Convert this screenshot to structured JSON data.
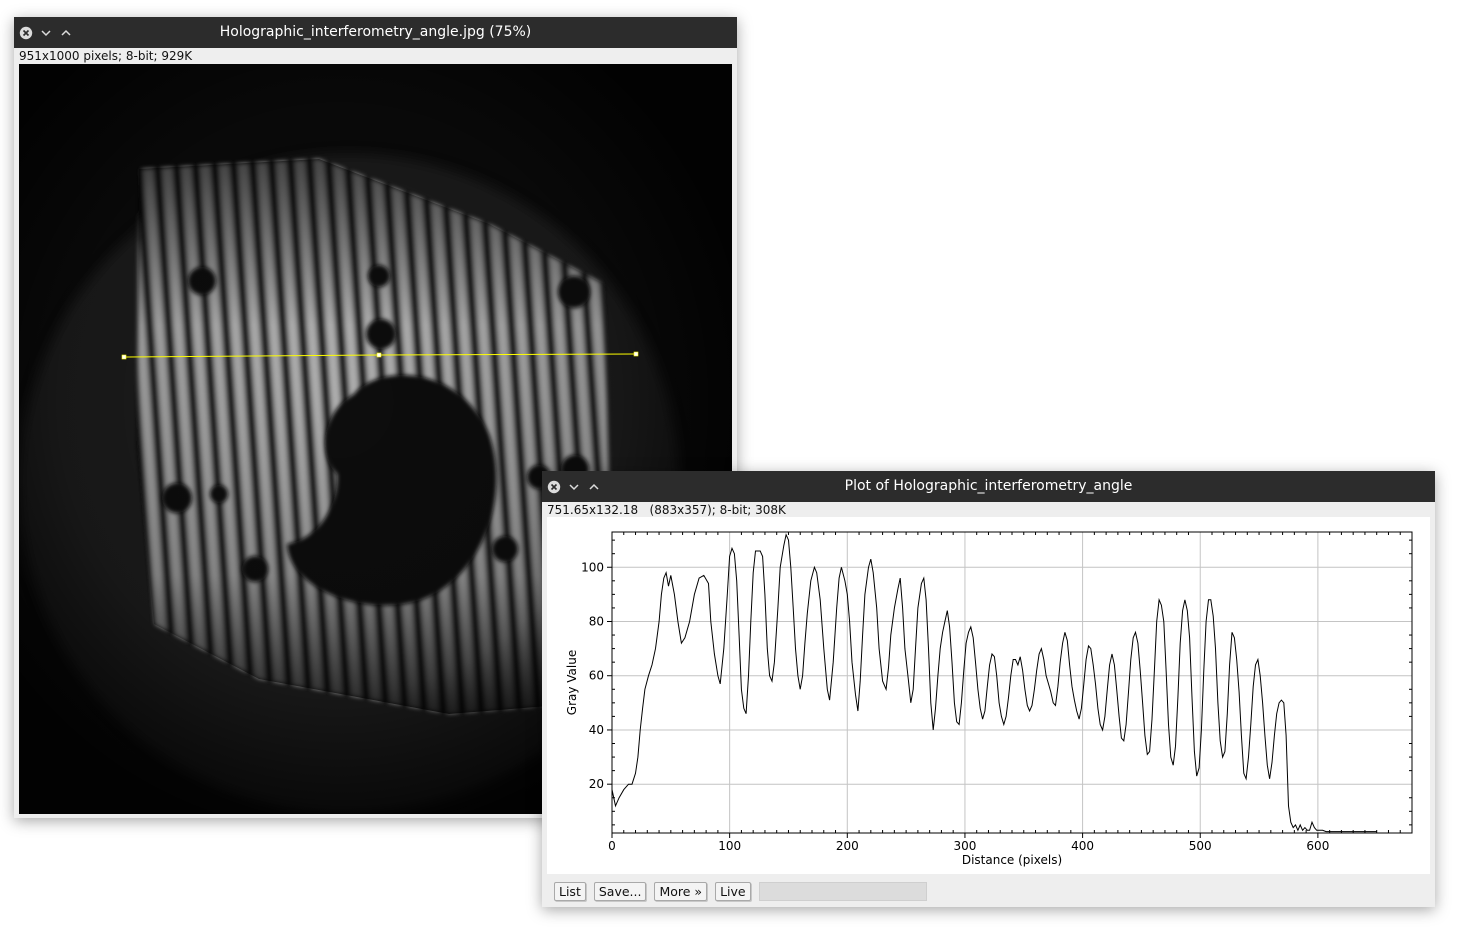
{
  "image_window": {
    "title": "Holographic_interferometry_angle.jpg (75%)",
    "info": "951x1000 pixels; 8-bit; 929K"
  },
  "plot_window": {
    "title": "Plot of Holographic_interferometry_angle",
    "info": "751.65x132.18   (883x357); 8-bit; 308K",
    "buttons": {
      "list": "List",
      "save": "Save...",
      "more": "More »",
      "live": "Live"
    }
  },
  "colors": {
    "titlebar": "#2c2c2c",
    "selection_line": "#ffff00",
    "plot_line": "#000000",
    "grid": "#bfbfbf"
  },
  "chart_data": {
    "type": "line",
    "xlabel": "Distance (pixels)",
    "ylabel": "Gray Value",
    "xlim": [
      0,
      680
    ],
    "ylim": [
      2,
      113
    ],
    "xticks": [
      0,
      100,
      200,
      300,
      400,
      500,
      600
    ],
    "yticks": [
      20,
      40,
      60,
      80,
      100
    ],
    "grid": true,
    "series": [
      {
        "points": [
          [
            0,
            18
          ],
          [
            3,
            12
          ],
          [
            6,
            15
          ],
          [
            10,
            18
          ],
          [
            14,
            20
          ],
          [
            17,
            20
          ],
          [
            20,
            24
          ],
          [
            22,
            30
          ],
          [
            24,
            40
          ],
          [
            26,
            48
          ],
          [
            28,
            55
          ],
          [
            31,
            60
          ],
          [
            34,
            64
          ],
          [
            37,
            70
          ],
          [
            40,
            80
          ],
          [
            42,
            90
          ],
          [
            44,
            96
          ],
          [
            46,
            98
          ],
          [
            48,
            93
          ],
          [
            50,
            97
          ],
          [
            53,
            90
          ],
          [
            56,
            80
          ],
          [
            59,
            72
          ],
          [
            62,
            74
          ],
          [
            66,
            80
          ],
          [
            70,
            90
          ],
          [
            74,
            96
          ],
          [
            78,
            97
          ],
          [
            82,
            94
          ],
          [
            84,
            80
          ],
          [
            87,
            68
          ],
          [
            90,
            60
          ],
          [
            92,
            57
          ],
          [
            95,
            70
          ],
          [
            98,
            90
          ],
          [
            100,
            104
          ],
          [
            102,
            107
          ],
          [
            104,
            105
          ],
          [
            106,
            95
          ],
          [
            108,
            75
          ],
          [
            110,
            55
          ],
          [
            112,
            48
          ],
          [
            114,
            46
          ],
          [
            116,
            60
          ],
          [
            118,
            80
          ],
          [
            120,
            98
          ],
          [
            122,
            106
          ],
          [
            126,
            106
          ],
          [
            128,
            104
          ],
          [
            130,
            90
          ],
          [
            132,
            70
          ],
          [
            134,
            60
          ],
          [
            136,
            58
          ],
          [
            138,
            65
          ],
          [
            141,
            85
          ],
          [
            143,
            100
          ],
          [
            146,
            108
          ],
          [
            148,
            112
          ],
          [
            150,
            110
          ],
          [
            152,
            100
          ],
          [
            154,
            85
          ],
          [
            156,
            70
          ],
          [
            158,
            60
          ],
          [
            160,
            55
          ],
          [
            162,
            60
          ],
          [
            164,
            72
          ],
          [
            166,
            83
          ],
          [
            169,
            95
          ],
          [
            172,
            100
          ],
          [
            174,
            98
          ],
          [
            177,
            88
          ],
          [
            180,
            70
          ],
          [
            183,
            55
          ],
          [
            185,
            51
          ],
          [
            188,
            65
          ],
          [
            191,
            85
          ],
          [
            193,
            96
          ],
          [
            195,
            100
          ],
          [
            198,
            95
          ],
          [
            200,
            90
          ],
          [
            202,
            80
          ],
          [
            204,
            65
          ],
          [
            207,
            53
          ],
          [
            209,
            47
          ],
          [
            211,
            58
          ],
          [
            213,
            75
          ],
          [
            215,
            90
          ],
          [
            218,
            100
          ],
          [
            220,
            103
          ],
          [
            222,
            98
          ],
          [
            225,
            85
          ],
          [
            227,
            70
          ],
          [
            230,
            58
          ],
          [
            233,
            55
          ],
          [
            235,
            63
          ],
          [
            237,
            75
          ],
          [
            240,
            85
          ],
          [
            243,
            92
          ],
          [
            245,
            96
          ],
          [
            247,
            85
          ],
          [
            249,
            70
          ],
          [
            252,
            58
          ],
          [
            254,
            50
          ],
          [
            256,
            55
          ],
          [
            258,
            70
          ],
          [
            260,
            85
          ],
          [
            263,
            94
          ],
          [
            265,
            96
          ],
          [
            267,
            88
          ],
          [
            269,
            70
          ],
          [
            271,
            50
          ],
          [
            273,
            40
          ],
          [
            275,
            48
          ],
          [
            277,
            60
          ],
          [
            279,
            70
          ],
          [
            281,
            76
          ],
          [
            283,
            80
          ],
          [
            285,
            84
          ],
          [
            287,
            78
          ],
          [
            289,
            65
          ],
          [
            291,
            50
          ],
          [
            293,
            43
          ],
          [
            295,
            42
          ],
          [
            297,
            50
          ],
          [
            299,
            62
          ],
          [
            301,
            72
          ],
          [
            303,
            76
          ],
          [
            305,
            78
          ],
          [
            307,
            74
          ],
          [
            309,
            65
          ],
          [
            311,
            55
          ],
          [
            313,
            48
          ],
          [
            315,
            44
          ],
          [
            317,
            47
          ],
          [
            319,
            56
          ],
          [
            321,
            64
          ],
          [
            323,
            68
          ],
          [
            325,
            67
          ],
          [
            327,
            60
          ],
          [
            329,
            50
          ],
          [
            331,
            45
          ],
          [
            333,
            42
          ],
          [
            335,
            45
          ],
          [
            337,
            52
          ],
          [
            339,
            60
          ],
          [
            341,
            66
          ],
          [
            343,
            66
          ],
          [
            345,
            64
          ],
          [
            347,
            67
          ],
          [
            349,
            62
          ],
          [
            351,
            55
          ],
          [
            353,
            49
          ],
          [
            355,
            47
          ],
          [
            357,
            49
          ],
          [
            359,
            55
          ],
          [
            361,
            62
          ],
          [
            363,
            68
          ],
          [
            365,
            70
          ],
          [
            367,
            66
          ],
          [
            369,
            60
          ],
          [
            371,
            57
          ],
          [
            373,
            54
          ],
          [
            375,
            50
          ],
          [
            377,
            49
          ],
          [
            379,
            56
          ],
          [
            381,
            65
          ],
          [
            383,
            72
          ],
          [
            385,
            76
          ],
          [
            387,
            73
          ],
          [
            389,
            64
          ],
          [
            391,
            56
          ],
          [
            393,
            51
          ],
          [
            395,
            47
          ],
          [
            397,
            44
          ],
          [
            399,
            48
          ],
          [
            401,
            57
          ],
          [
            403,
            66
          ],
          [
            405,
            71
          ],
          [
            407,
            70
          ],
          [
            409,
            64
          ],
          [
            411,
            57
          ],
          [
            413,
            48
          ],
          [
            415,
            42
          ],
          [
            417,
            40
          ],
          [
            419,
            45
          ],
          [
            421,
            55
          ],
          [
            423,
            64
          ],
          [
            425,
            68
          ],
          [
            427,
            64
          ],
          [
            429,
            55
          ],
          [
            431,
            45
          ],
          [
            433,
            37
          ],
          [
            435,
            36
          ],
          [
            437,
            42
          ],
          [
            439,
            54
          ],
          [
            441,
            66
          ],
          [
            443,
            74
          ],
          [
            445,
            76
          ],
          [
            447,
            72
          ],
          [
            449,
            62
          ],
          [
            451,
            50
          ],
          [
            453,
            38
          ],
          [
            455,
            31
          ],
          [
            457,
            32
          ],
          [
            459,
            44
          ],
          [
            461,
            62
          ],
          [
            463,
            80
          ],
          [
            465,
            88
          ],
          [
            467,
            86
          ],
          [
            469,
            80
          ],
          [
            471,
            62
          ],
          [
            473,
            42
          ],
          [
            475,
            30
          ],
          [
            477,
            27
          ],
          [
            479,
            34
          ],
          [
            481,
            52
          ],
          [
            483,
            72
          ],
          [
            485,
            84
          ],
          [
            487,
            88
          ],
          [
            489,
            84
          ],
          [
            491,
            74
          ],
          [
            493,
            52
          ],
          [
            495,
            32
          ],
          [
            497,
            23
          ],
          [
            499,
            26
          ],
          [
            501,
            40
          ],
          [
            503,
            62
          ],
          [
            505,
            80
          ],
          [
            507,
            88
          ],
          [
            509,
            88
          ],
          [
            511,
            82
          ],
          [
            513,
            70
          ],
          [
            515,
            50
          ],
          [
            517,
            36
          ],
          [
            519,
            30
          ],
          [
            521,
            32
          ],
          [
            523,
            46
          ],
          [
            525,
            64
          ],
          [
            527,
            76
          ],
          [
            529,
            74
          ],
          [
            531,
            66
          ],
          [
            533,
            54
          ],
          [
            535,
            38
          ],
          [
            537,
            24
          ],
          [
            539,
            22
          ],
          [
            541,
            30
          ],
          [
            543,
            42
          ],
          [
            545,
            56
          ],
          [
            547,
            64
          ],
          [
            549,
            66
          ],
          [
            551,
            60
          ],
          [
            553,
            50
          ],
          [
            555,
            38
          ],
          [
            557,
            27
          ],
          [
            559,
            22
          ],
          [
            561,
            28
          ],
          [
            563,
            38
          ],
          [
            565,
            46
          ],
          [
            567,
            50
          ],
          [
            569,
            51
          ],
          [
            571,
            50
          ],
          [
            573,
            38
          ],
          [
            575,
            12
          ],
          [
            577,
            6
          ],
          [
            579,
            4
          ],
          [
            581,
            5
          ],
          [
            583,
            3
          ],
          [
            585,
            5
          ],
          [
            587,
            3
          ],
          [
            589,
            4
          ],
          [
            591,
            3
          ],
          [
            593,
            3
          ],
          [
            595,
            6
          ],
          [
            597,
            4
          ],
          [
            599,
            3
          ],
          [
            601,
            3
          ],
          [
            604,
            3
          ],
          [
            607,
            2.5
          ],
          [
            612,
            2.5
          ],
          [
            618,
            2.5
          ],
          [
            625,
            2.5
          ],
          [
            632,
            2.5
          ],
          [
            640,
            2.5
          ],
          [
            646,
            2.5
          ],
          [
            650,
            2.5
          ]
        ]
      }
    ]
  }
}
